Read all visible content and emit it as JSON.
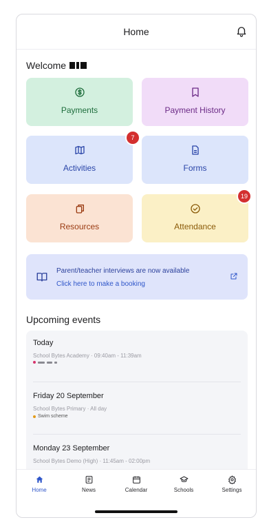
{
  "header": {
    "title": "Home"
  },
  "welcome": {
    "label": "Welcome"
  },
  "tiles": [
    {
      "label": "Payments",
      "icon": "dollar-circle-icon",
      "bg": "#d3f0df",
      "fg": "#1f6e3d"
    },
    {
      "label": "Payment History",
      "icon": "bookmark-icon",
      "bg": "#f1dcf8",
      "fg": "#6b2a86"
    },
    {
      "label": "Activities",
      "icon": "map-icon",
      "bg": "#dce5fb",
      "fg": "#2a45a8",
      "badge": "7"
    },
    {
      "label": "Forms",
      "icon": "document-icon",
      "bg": "#dce5fb",
      "fg": "#2a45a8"
    },
    {
      "label": "Resources",
      "icon": "copy-icon",
      "bg": "#fbe3d3",
      "fg": "#9a3b12"
    },
    {
      "label": "Attendance",
      "icon": "check-circle-icon",
      "bg": "#fbf0c6",
      "fg": "#8a5a08",
      "badge": "19"
    }
  ],
  "banner": {
    "line1": "Parent/teacher interviews are now available",
    "line2": "Click here to make a booking"
  },
  "events": {
    "title": "Upcoming events",
    "items": [
      {
        "day": "Today",
        "meta": "School Bytes Academy · 09:40am - 11:39am"
      },
      {
        "day": "Friday 20 September",
        "meta": "School Bytes Primary · All day",
        "tag": "Swim scheme",
        "tag_color": "#e39b1a"
      },
      {
        "day": "Monday 23 September",
        "meta": "School Bytes Demo (High) · 11:45am - 02:00pm"
      }
    ]
  },
  "tabbar": [
    {
      "label": "Home",
      "icon": "home-icon",
      "active": true
    },
    {
      "label": "News",
      "icon": "news-icon"
    },
    {
      "label": "Calendar",
      "icon": "calendar-icon"
    },
    {
      "label": "Schools",
      "icon": "school-icon"
    },
    {
      "label": "Settings",
      "icon": "gear-icon"
    }
  ],
  "colors": {
    "accent": "#2f56c9",
    "badge": "#d32f2f",
    "today_dot": "#d6336c"
  }
}
